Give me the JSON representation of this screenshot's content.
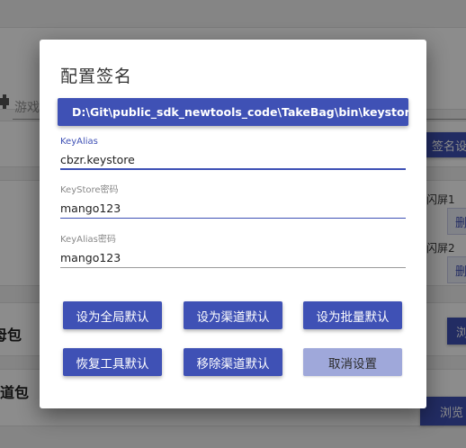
{
  "background": {
    "game_field_placeholder": "游戏",
    "sign_settings_button": "签名设置",
    "splash_label_1": "闪屏1",
    "splash_label_2": "闪屏2",
    "delete_button_1": "删",
    "delete_button_2": "删",
    "row_label_1": "母包",
    "row_label_2": "渠道包",
    "browse_button_1": "浏",
    "browse_button_2": "浏览"
  },
  "dialog": {
    "title": "配置签名",
    "keystore_path": "D:\\Git\\public_sdk_newtools_code\\TakeBag\\bin\\keystore\\",
    "fields": {
      "key_alias": {
        "label": "KeyAlias",
        "value": "cbzr.keystore"
      },
      "keystore_password": {
        "label": "KeyStore密码",
        "value": "mango123"
      },
      "key_alias_password": {
        "label": "KeyAlias密码",
        "value": "mango123"
      }
    },
    "buttons": {
      "set_global_default": "设为全局默认",
      "set_channel_default": "设为渠道默认",
      "set_batch_default": "设为批量默认",
      "restore_tool_default": "恢复工具默认",
      "remove_channel_default": "移除渠道默认",
      "cancel_settings": "取消设置"
    }
  },
  "colors": {
    "primary": "#3f51b5",
    "primary_disabled": "#9fa8da"
  }
}
